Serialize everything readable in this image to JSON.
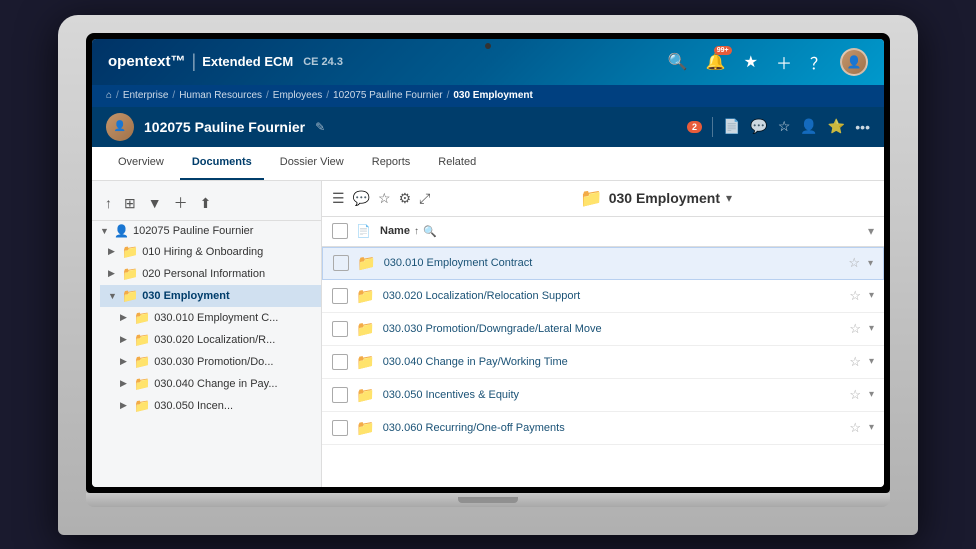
{
  "app": {
    "brand": "opentext™",
    "product": "Extended ECM",
    "version": "CE 24.3"
  },
  "topbar": {
    "search_label": "Search",
    "notification_badge": "99+",
    "favorites_label": "Favorites",
    "add_label": "Add",
    "help_label": "Help"
  },
  "breadcrumb": {
    "home": "⌂",
    "items": [
      "Enterprise",
      "Human Resources",
      "Employees",
      "102075 Pauline Fournier",
      "030 Employment"
    ]
  },
  "titlebar": {
    "employee_name": "102075 Pauline Fournier",
    "notification_count": "2"
  },
  "nav_tabs": [
    {
      "label": "Overview",
      "active": false
    },
    {
      "label": "Documents",
      "active": true
    },
    {
      "label": "Dossier View",
      "active": false
    },
    {
      "label": "Reports",
      "active": false
    },
    {
      "label": "Related",
      "active": false
    }
  ],
  "sidebar": {
    "root_label": "102075 Pauline Fournier",
    "items": [
      {
        "id": "010",
        "label": "010 Hiring & Onboarding",
        "indent": 1,
        "expanded": false
      },
      {
        "id": "020",
        "label": "020 Personal Information",
        "indent": 1,
        "expanded": false
      },
      {
        "id": "030",
        "label": "030 Employment",
        "indent": 1,
        "expanded": true,
        "selected": true
      },
      {
        "id": "030-010",
        "label": "030.010 Employment C...",
        "indent": 2,
        "expanded": false
      },
      {
        "id": "030-020",
        "label": "030.020 Localization/R...",
        "indent": 2,
        "expanded": false
      },
      {
        "id": "030-030",
        "label": "030.030 Promotion/Do...",
        "indent": 2,
        "expanded": false
      },
      {
        "id": "030-040",
        "label": "030.040 Change in Pay...",
        "indent": 2,
        "expanded": false
      },
      {
        "id": "030-050",
        "label": "030.050 Incen...",
        "indent": 2,
        "expanded": false
      }
    ]
  },
  "content": {
    "folder_title": "030 Employment",
    "table_header": {
      "name_col": "Name",
      "sort_dir": "↑"
    },
    "rows": [
      {
        "id": 1,
        "name": "030.010 Employment Contract",
        "highlighted": true
      },
      {
        "id": 2,
        "name": "030.020 Localization/Relocation Support",
        "highlighted": false
      },
      {
        "id": 3,
        "name": "030.030 Promotion/Downgrade/Lateral Move",
        "highlighted": false
      },
      {
        "id": 4,
        "name": "030.040 Change in Pay/Working Time",
        "highlighted": false
      },
      {
        "id": 5,
        "name": "030.050 Incentives & Equity",
        "highlighted": false
      },
      {
        "id": 6,
        "name": "030.060 Recurring/One-off Payments",
        "highlighted": false
      }
    ]
  }
}
